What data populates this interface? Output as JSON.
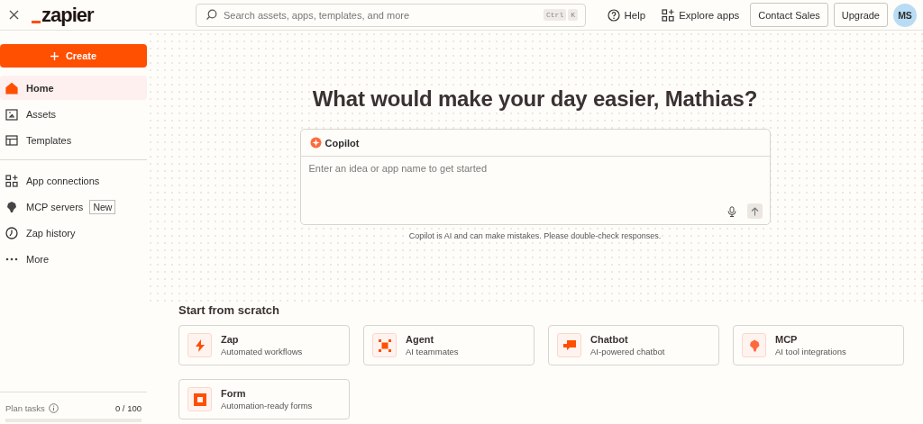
{
  "header": {
    "logo": "zapier",
    "search": {
      "placeholder": "Search assets, apps, templates, and more",
      "shortcut": [
        "Ctrl",
        "K"
      ]
    },
    "help": "Help",
    "explore": "Explore apps",
    "contact": "Contact Sales",
    "upgrade": "Upgrade",
    "avatar": "MS"
  },
  "sidebar": {
    "create": "Create",
    "items": [
      {
        "label": "Home",
        "selected": true
      },
      {
        "label": "Assets",
        "selected": false
      },
      {
        "label": "Templates",
        "selected": false
      },
      {
        "label": "App connections",
        "selected": false,
        "group_start": true
      },
      {
        "label": "MCP servers",
        "selected": false,
        "badge": "New"
      },
      {
        "label": "Zap history",
        "selected": false
      },
      {
        "label": "More",
        "selected": false
      }
    ],
    "plan": {
      "label": "Plan tasks",
      "reading": "0 / 100",
      "level": 0
    }
  },
  "main": {
    "heading": "What would make your day easier, Mathias?",
    "copilot": {
      "title": "Copilot",
      "placeholder": "Enter an idea or app name to get started",
      "disclaimer": "Copilot is AI and can make mistakes. Please double-check responses."
    },
    "scratch": {
      "title": "Start from scratch",
      "cards": [
        {
          "kind": "zap",
          "title": "Zap",
          "subtitle": "Automated workflows"
        },
        {
          "kind": "agent",
          "title": "Agent",
          "subtitle": "AI teammates"
        },
        {
          "kind": "chatbot",
          "title": "Chatbot",
          "subtitle": "AI-powered chatbot"
        },
        {
          "kind": "mcp",
          "title": "MCP",
          "subtitle": "AI tool integrations"
        },
        {
          "kind": "form",
          "title": "Form",
          "subtitle": "Automation-ready forms"
        }
      ]
    }
  }
}
